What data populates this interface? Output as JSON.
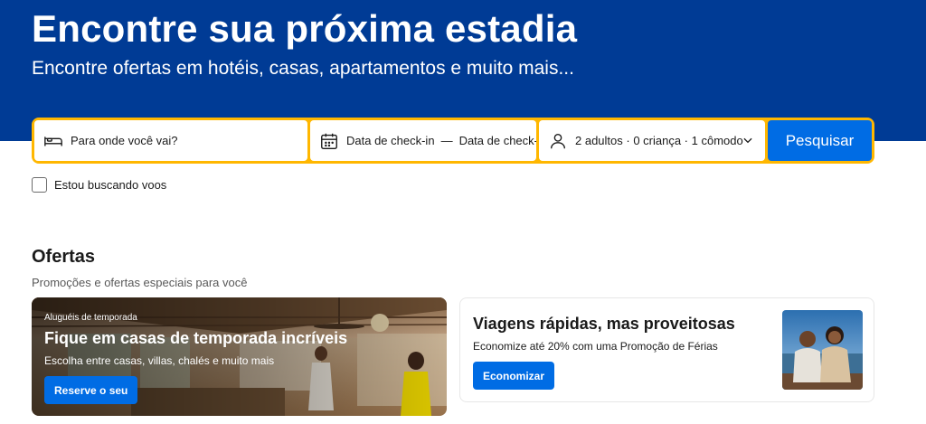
{
  "hero": {
    "title": "Encontre sua próxima estadia",
    "subtitle": "Encontre ofertas em hotéis, casas, apartamentos e muito mais..."
  },
  "search": {
    "destination_placeholder": "Para onde você vai?",
    "checkin_label": "Data de check-in",
    "date_separator": "—",
    "checkout_label": "Data de check-",
    "occupancy": "2 adultos · 0 criança · 1 cômodo",
    "button_label": "Pesquisar",
    "icons": {
      "destination": "bed-icon",
      "dates": "calendar-icon",
      "occupancy": "person-icon",
      "dropdown": "chevron-down-icon"
    }
  },
  "flights_option": {
    "label": "Estou buscando voos",
    "checked": false
  },
  "offers": {
    "title": "Ofertas",
    "subtitle": "Promoções e ofertas especiais para você",
    "cards": [
      {
        "kicker": "Aluguéis de temporada",
        "title": "Fique em casas de temporada incríveis",
        "text": "Escolha entre casas, villas, chalés e muito mais",
        "button": "Reserve o seu"
      },
      {
        "title": "Viagens rápidas, mas proveitosas",
        "text": "Economize até 20% com uma Promoção de Férias",
        "button": "Economizar"
      }
    ]
  },
  "colors": {
    "hero_bg": "#003b95",
    "search_border": "#ffb700",
    "primary_button": "#006ce4"
  }
}
